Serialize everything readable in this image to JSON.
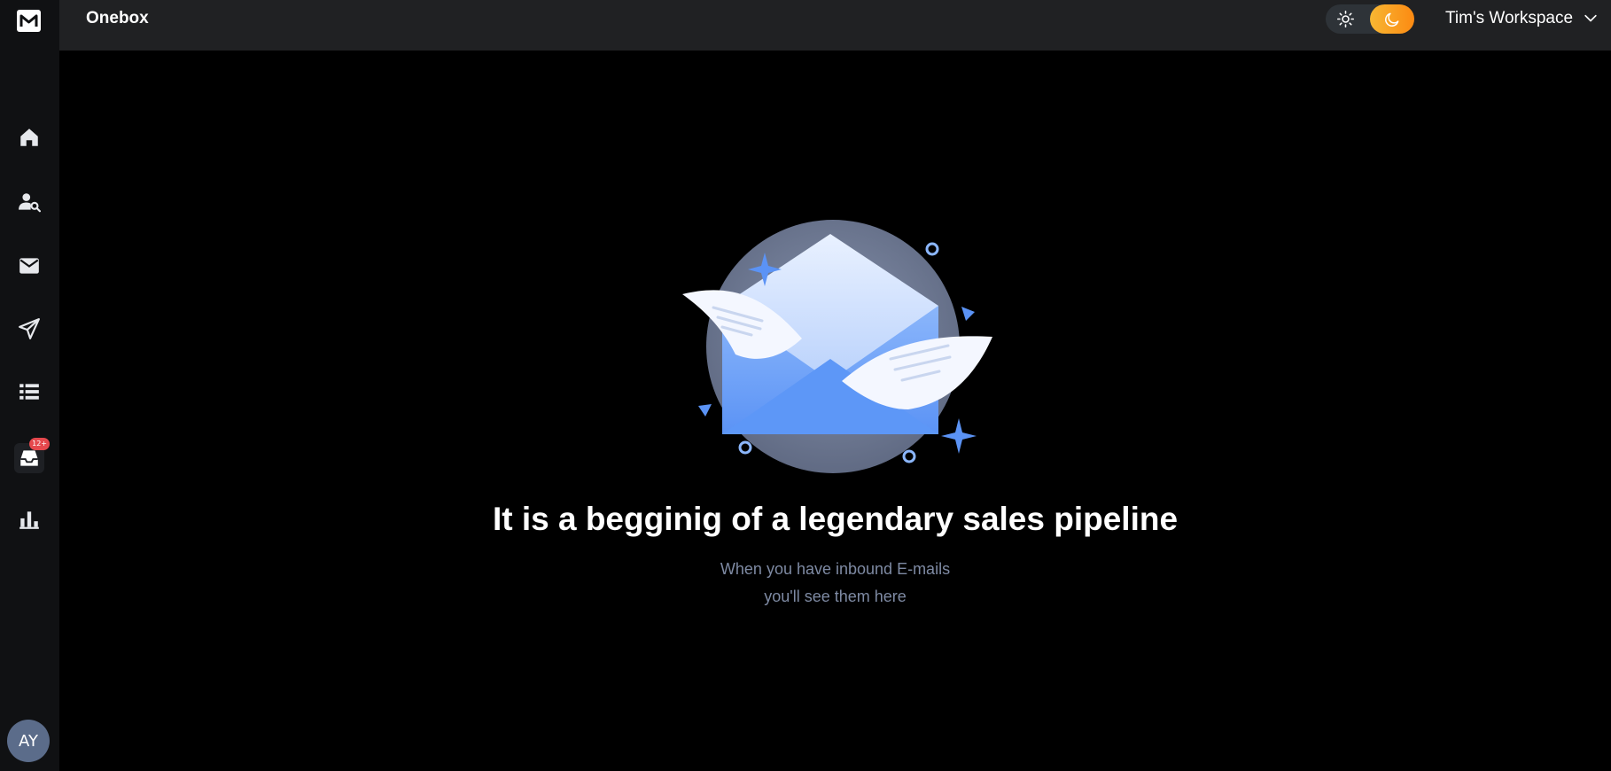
{
  "app": {
    "title": "Onebox"
  },
  "header": {
    "workspace_name": "Tim's Workspace",
    "theme": "dark"
  },
  "sidebar": {
    "items": [
      {
        "icon": "home-icon"
      },
      {
        "icon": "user-search-icon"
      },
      {
        "icon": "mail-icon"
      },
      {
        "icon": "send-icon"
      },
      {
        "icon": "list-icon"
      },
      {
        "icon": "inbox-icon",
        "badge": "12+"
      },
      {
        "icon": "bar-chart-icon"
      }
    ],
    "avatar_initials": "AY"
  },
  "empty_state": {
    "title": "It is a begginig of a legendary sales pipeline",
    "line1": "When you have inbound E-mails",
    "line2": "you'll see them here"
  },
  "colors": {
    "sidebar_bg": "#101113",
    "topbar_bg": "#202123",
    "accent_orange": "#fc8a12",
    "accent_blue": "#5b93f5",
    "badge_red": "#e5484d"
  }
}
